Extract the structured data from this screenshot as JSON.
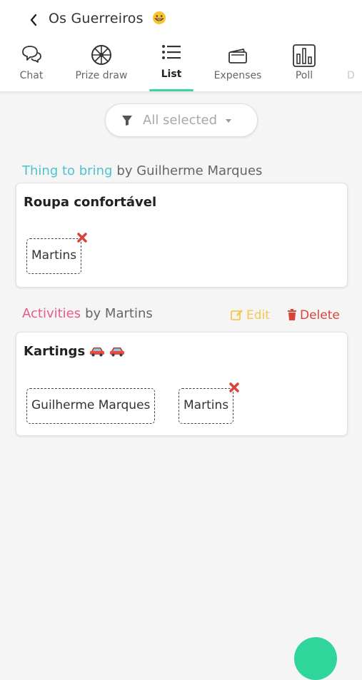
{
  "header": {
    "title": "Os Guerreiros",
    "title_emoji": "grinning-face-icon"
  },
  "tabs": [
    {
      "label": "Chat",
      "icon": "chat-bubbles-icon"
    },
    {
      "label": "Prize draw",
      "icon": "prize-wheel-icon"
    },
    {
      "label": "List",
      "icon": "list-icon",
      "active": true
    },
    {
      "label": "Expenses",
      "icon": "wallet-icon"
    },
    {
      "label": "Poll",
      "icon": "bar-chart-icon"
    },
    {
      "label": "D",
      "icon": "truncated-tab"
    }
  ],
  "filter": {
    "label": "All selected"
  },
  "items": [
    {
      "category": "Thing to bring",
      "by": "by Guilherme Marques",
      "title": "Roupa confortável",
      "people": [
        {
          "name": "Martins",
          "removable": true
        }
      ]
    },
    {
      "category": "Activities",
      "by": "by Martins",
      "title": "Kartings",
      "title_emojis": [
        "car-icon",
        "car-icon"
      ],
      "actions": {
        "edit": "Edit",
        "delete": "Delete"
      },
      "people": [
        {
          "name": "Guilherme Marques",
          "removable": false
        },
        {
          "name": "Martins",
          "removable": true
        }
      ]
    }
  ],
  "colors": {
    "accent": "#3bd3a4",
    "category_teal": "#4bc4cf",
    "category_pink": "#e75c86",
    "edit": "#f2c94c",
    "delete": "#d9433a",
    "remove_x": "#d9433a"
  }
}
